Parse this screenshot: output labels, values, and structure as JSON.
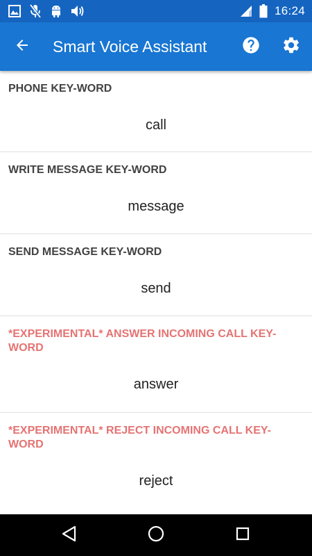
{
  "status_bar": {
    "time": "16:24",
    "left_icons": [
      "image-icon",
      "mic-off-icon",
      "android-icon",
      "volume-icon"
    ],
    "right_icons": [
      "signal-icon",
      "battery-icon"
    ]
  },
  "app_bar": {
    "title": "Smart Voice Assistant",
    "back_icon": "arrow-back-icon",
    "help_icon": "help-icon",
    "settings_icon": "gear-icon",
    "color": "#1976d2"
  },
  "settings": [
    {
      "label": "PHONE KEY-WORD",
      "value": "call",
      "experimental": false
    },
    {
      "label": "WRITE MESSAGE KEY-WORD",
      "value": "message",
      "experimental": false
    },
    {
      "label": "SEND MESSAGE KEY-WORD",
      "value": "send",
      "experimental": false
    },
    {
      "label": "*EXPERIMENTAL* ANSWER INCOMING CALL KEY-WORD",
      "value": "answer",
      "experimental": true
    },
    {
      "label": "*EXPERIMENTAL* REJECT INCOMING CALL KEY-WORD",
      "value": "reject",
      "experimental": true
    }
  ],
  "colors": {
    "status_bar": "#1565c0",
    "app_bar": "#1976d2",
    "label": "#424242",
    "experimental_label": "#e57373",
    "divider": "#e0e0e0"
  },
  "nav_bar": {
    "icons": [
      "nav-back-icon",
      "nav-home-icon",
      "nav-recents-icon"
    ]
  }
}
